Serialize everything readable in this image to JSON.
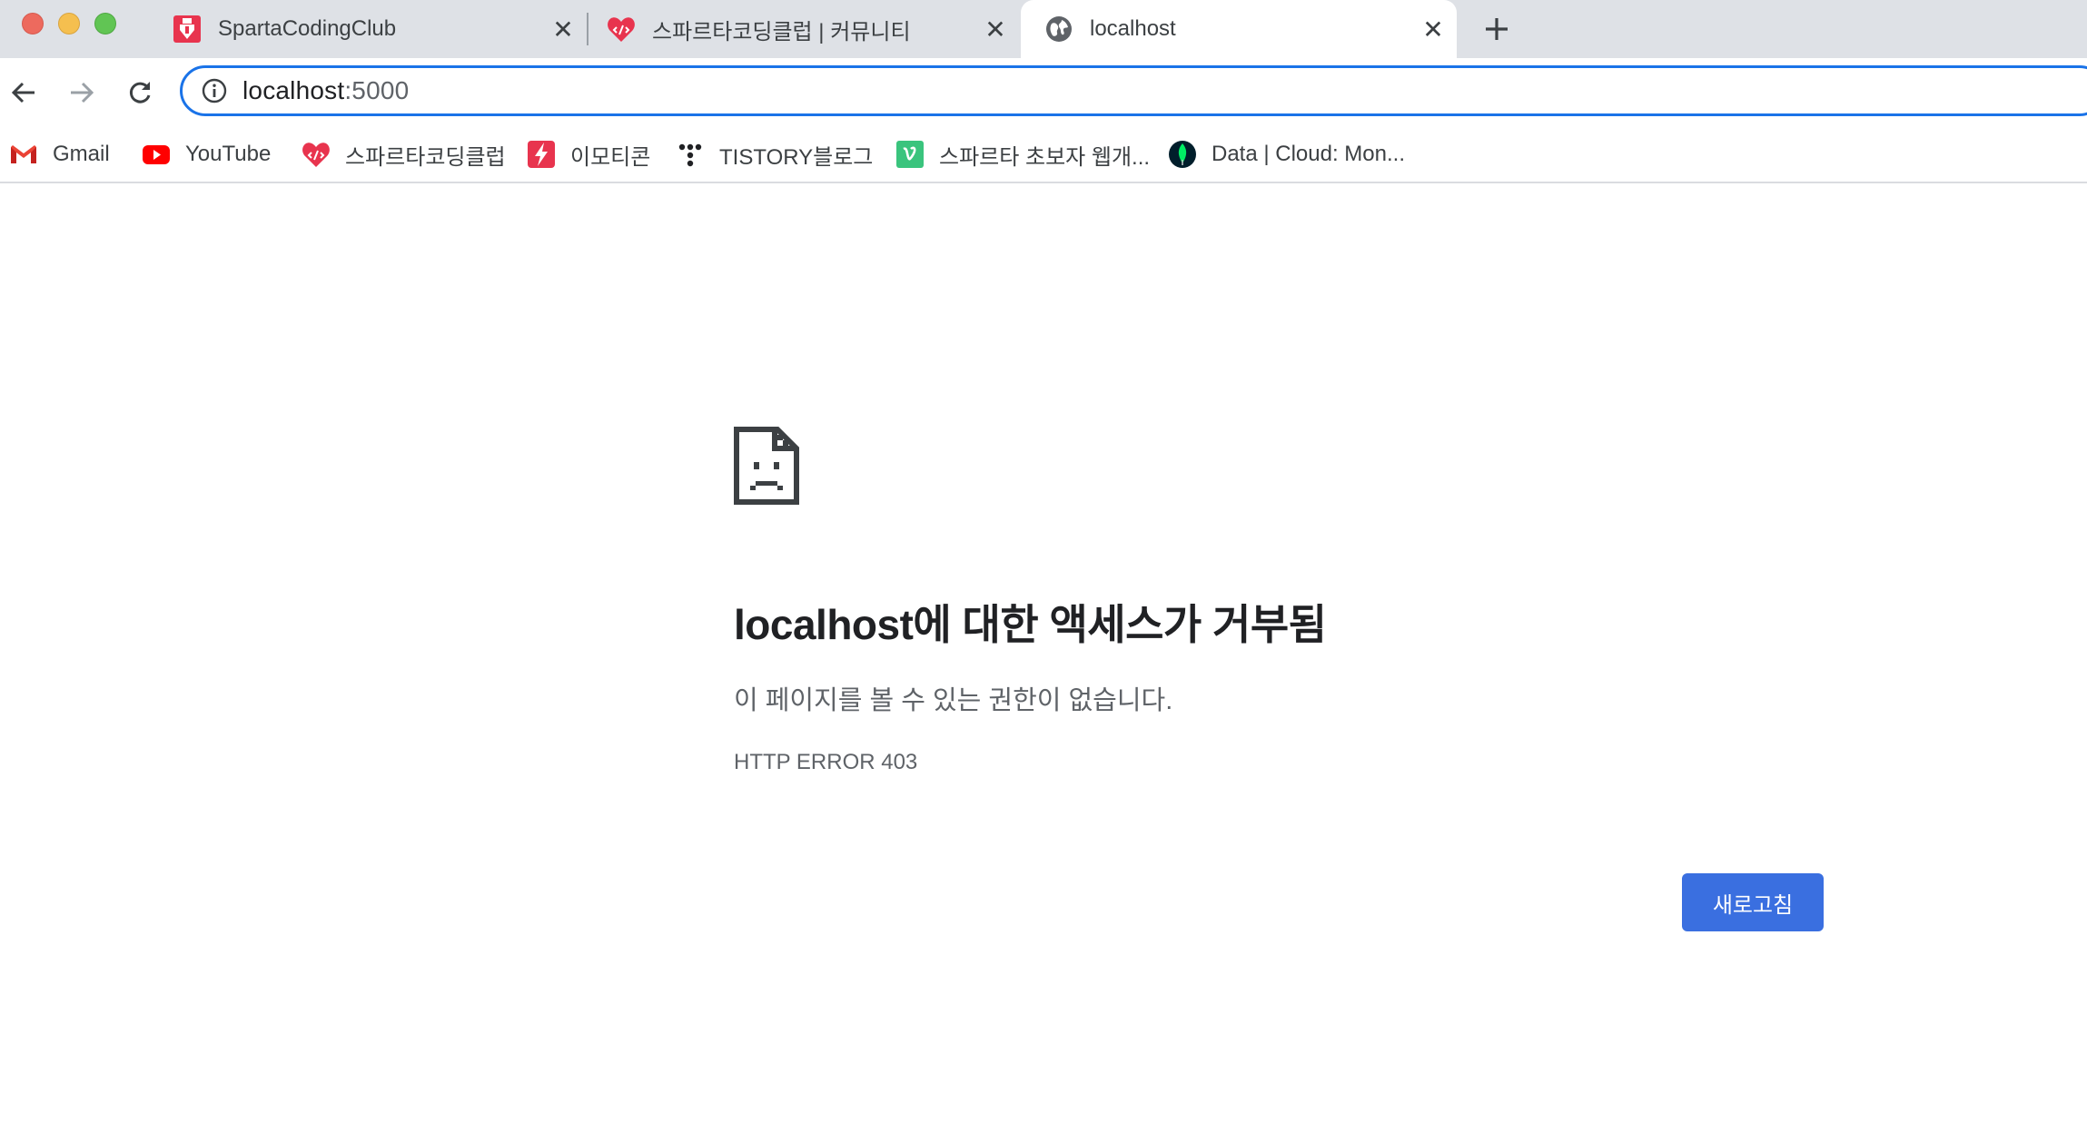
{
  "tabs": [
    {
      "title": "SpartaCodingClub",
      "icon": "sparta-logo-icon"
    },
    {
      "title": "스파르타코딩클럽 | 커뮤니티",
      "icon": "sparta-community-icon"
    },
    {
      "title": "localhost",
      "icon": "globe-icon",
      "active": true
    }
  ],
  "toolbar": {
    "url_host": "localhost",
    "url_port": ":5000"
  },
  "bookmarks": [
    {
      "label": "Gmail",
      "icon": "gmail-icon"
    },
    {
      "label": "YouTube",
      "icon": "youtube-icon"
    },
    {
      "label": "스파르타코딩클럽",
      "icon": "sparta-community-icon"
    },
    {
      "label": "이모티콘",
      "icon": "emoticon-bolt-icon"
    },
    {
      "label": "TISTORY블로그",
      "icon": "tistory-icon"
    },
    {
      "label": "스파르타 초보자 웹개...",
      "icon": "vimeo-v-icon"
    },
    {
      "label": "Data | Cloud: Mon...",
      "icon": "mongodb-leaf-icon"
    }
  ],
  "error": {
    "title": "localhost에 대한 액세스가 거부됨",
    "description": "이 페이지를 볼 수 있는 권한이 없습니다.",
    "code": "HTTP ERROR 403",
    "reload_label": "새로고침"
  },
  "colors": {
    "accent": "#1a73e8",
    "button": "#3a6fe0",
    "tabstrip": "#dee1e6"
  }
}
